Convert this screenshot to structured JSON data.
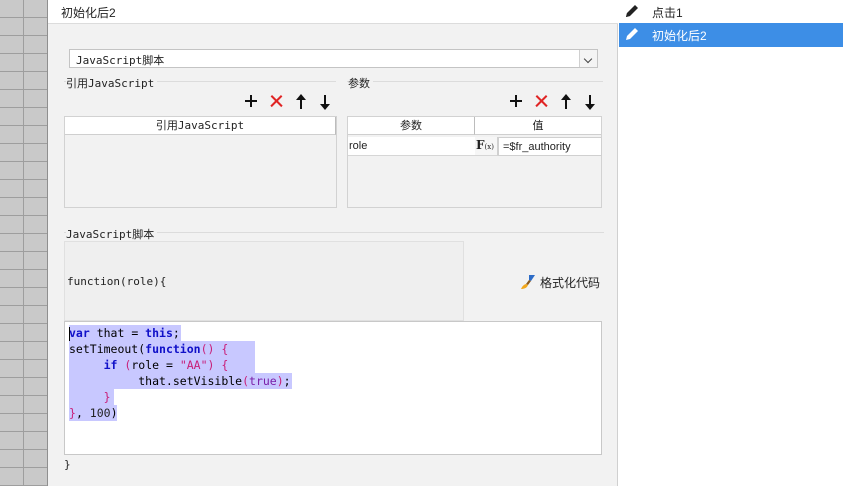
{
  "panel": {
    "title": "初始化后2"
  },
  "script_type": {
    "selected": "JavaScript脚本"
  },
  "ref_section": {
    "label": "引用JavaScript",
    "column_header": "引用JavaScript"
  },
  "params_section": {
    "label": "参数",
    "col_param": "参数",
    "col_value": "值",
    "rows": [
      {
        "param": "role",
        "value": "=$fr_authority"
      }
    ]
  },
  "script_section": {
    "label": "JavaScript脚本",
    "function_header": "function(role){",
    "format_button": "格式化代码",
    "closing": "}",
    "code": [
      "var that = this;",
      "setTimeout(function() {",
      "     if (role = \"AA\") {",
      "          that.setVisible(true);",
      "     }",
      "}, 100)"
    ]
  },
  "events": [
    {
      "label": "点击1",
      "selected": false
    },
    {
      "label": "初始化后2",
      "selected": true
    }
  ],
  "colors": {
    "selection": "#3d8ee6",
    "delete": "#e02424",
    "code_selection": "#c8c8ff"
  }
}
